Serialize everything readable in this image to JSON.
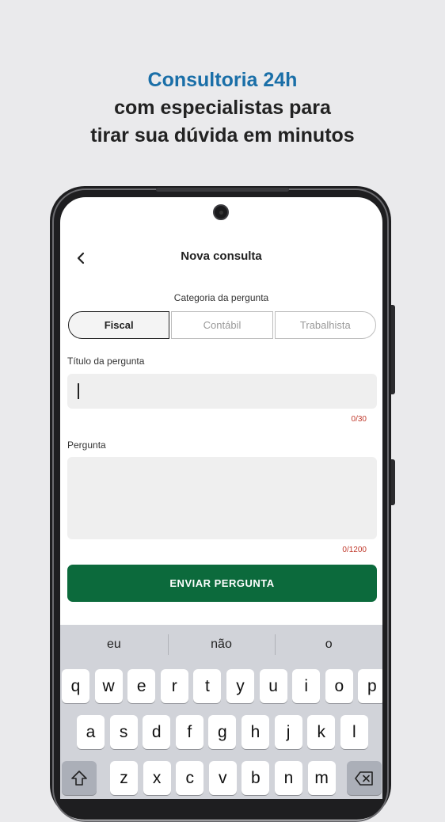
{
  "headline": {
    "line1": "Consultoria 24h",
    "line2": "com especialistas para",
    "line3": "tirar sua dúvida em minutos"
  },
  "header": {
    "back_icon": "chevron-left-icon",
    "title": "Nova consulta"
  },
  "category": {
    "label": "Categoria da pergunta",
    "options": [
      "Fiscal",
      "Contábil",
      "Trabalhista"
    ],
    "selected": "Fiscal"
  },
  "title_field": {
    "label": "Título da pergunta",
    "value": "",
    "counter": "0/30"
  },
  "question_field": {
    "label": "Pergunta",
    "value": "",
    "counter": "0/1200"
  },
  "submit_label": "ENVIAR PERGUNTA",
  "keyboard": {
    "suggestions": [
      "eu",
      "não",
      "o"
    ],
    "row1": [
      "q",
      "w",
      "e",
      "r",
      "t",
      "y",
      "u",
      "i",
      "o",
      "p"
    ],
    "row2": [
      "a",
      "s",
      "d",
      "f",
      "g",
      "h",
      "j",
      "k",
      "l"
    ],
    "row3": [
      "z",
      "x",
      "c",
      "v",
      "b",
      "n",
      "m"
    ],
    "shift_icon": "shift-icon",
    "delete_icon": "backspace-icon"
  },
  "colors": {
    "accent_blue": "#1a6fa8",
    "button_green": "#0c6a3c",
    "counter_red": "#c0392b"
  }
}
